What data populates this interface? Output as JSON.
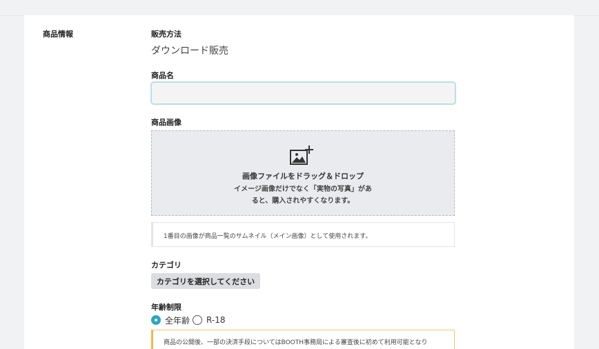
{
  "section": {
    "title": "商品情報"
  },
  "sales_method": {
    "label": "販売方法",
    "value": "ダウンロード販売"
  },
  "product_name": {
    "label": "商品名",
    "value": "",
    "placeholder": ""
  },
  "product_image": {
    "label": "商品画像",
    "icon": "add-image-icon",
    "drop_title": "画像ファイルをドラッグ＆ドロップ",
    "drop_sub_line1": "イメージ画像だけでなく「実物の写真」があ",
    "drop_sub_line2": "ると、購入されやすくなります。",
    "note": "1番目の画像が商品一覧のサムネイル（メイン画像）として使用されます。"
  },
  "category": {
    "label": "カテゴリ",
    "button": "カテゴリを選択してください"
  },
  "age_restriction": {
    "label": "年齢制限",
    "options": [
      {
        "label": "全年齢",
        "selected": true
      },
      {
        "label": "R-18",
        "selected": false
      }
    ],
    "warning": "商品の公開後、一部の決済手段についてはBOOTH事務局による審査後に初めて利用可能となり"
  },
  "colors": {
    "accent": "#2ba7c3",
    "input_focus": "#b9dfe6",
    "warning": "#f0b64d"
  }
}
